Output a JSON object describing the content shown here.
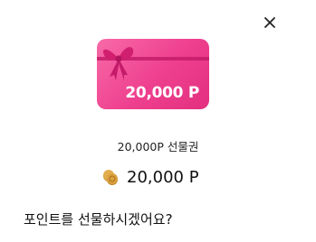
{
  "dialog": {
    "close_icon": "close-icon",
    "card": {
      "amount": "20,000 P",
      "colors": {
        "card_top": "#f86aa8",
        "card_bottom": "#e3307f",
        "ribbon": "#c41c6a"
      }
    },
    "voucher_name": "20,000P 선물권",
    "price": {
      "icon": "coin-stack-icon",
      "value": "20,000 P",
      "coin_color": "#d9a441"
    },
    "question": "포인트를 선물하시겠어요?"
  }
}
